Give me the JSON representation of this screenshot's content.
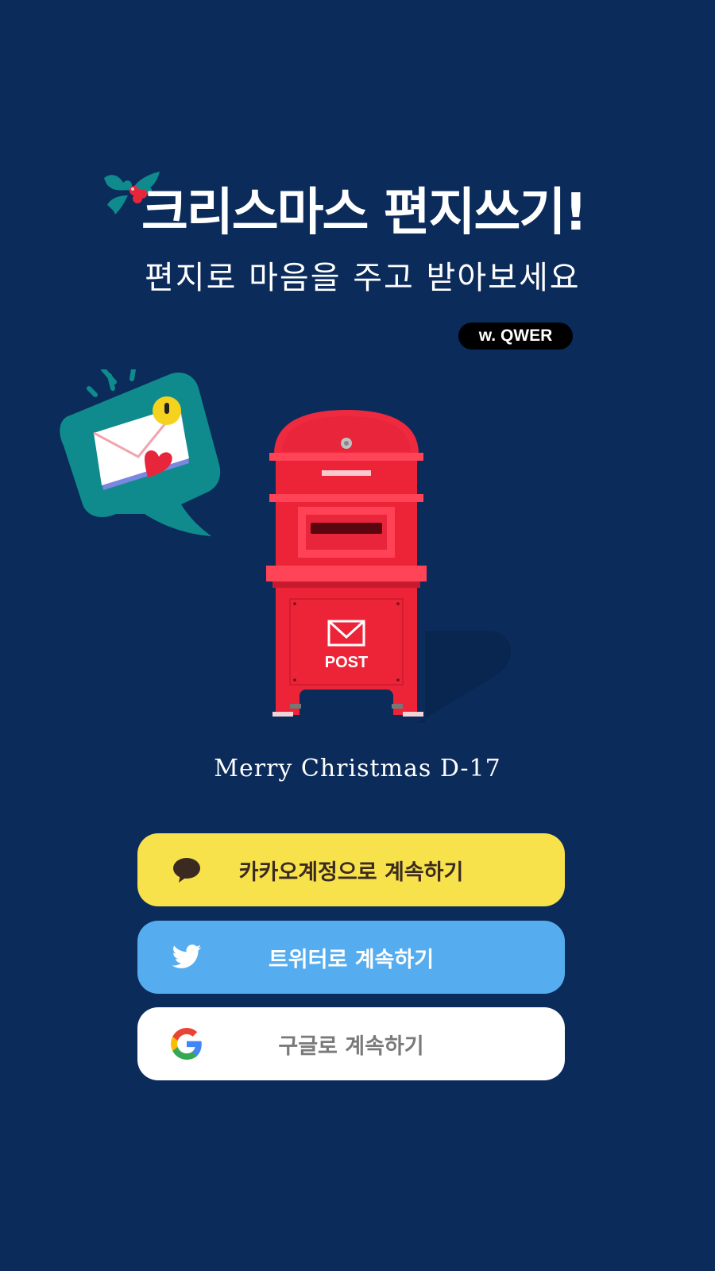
{
  "header": {
    "title": "크리스마스 편지쓰기!",
    "subtitle": "편지로 마음을 주고 받아보세요",
    "badge": "w. QWER"
  },
  "illustration": {
    "mailbox_label": "POST",
    "bubble_icon": "love-letter-icon",
    "holly_icon": "holly-icon"
  },
  "countdown": {
    "text": "Merry Christmas D-17"
  },
  "login": {
    "kakao": {
      "label": "카카오계정으로 계속하기",
      "icon": "kakao-talk-icon",
      "color": "#f7e24b"
    },
    "twitter": {
      "label": "트위터로 계속하기",
      "icon": "twitter-icon",
      "color": "#55acee"
    },
    "google": {
      "label": "구글로 계속하기",
      "icon": "google-icon",
      "color": "#ffffff"
    }
  },
  "colors": {
    "background": "#0b2b5b",
    "mailbox_red": "#ef2a3f",
    "bubble_teal": "#0f8b8d"
  }
}
